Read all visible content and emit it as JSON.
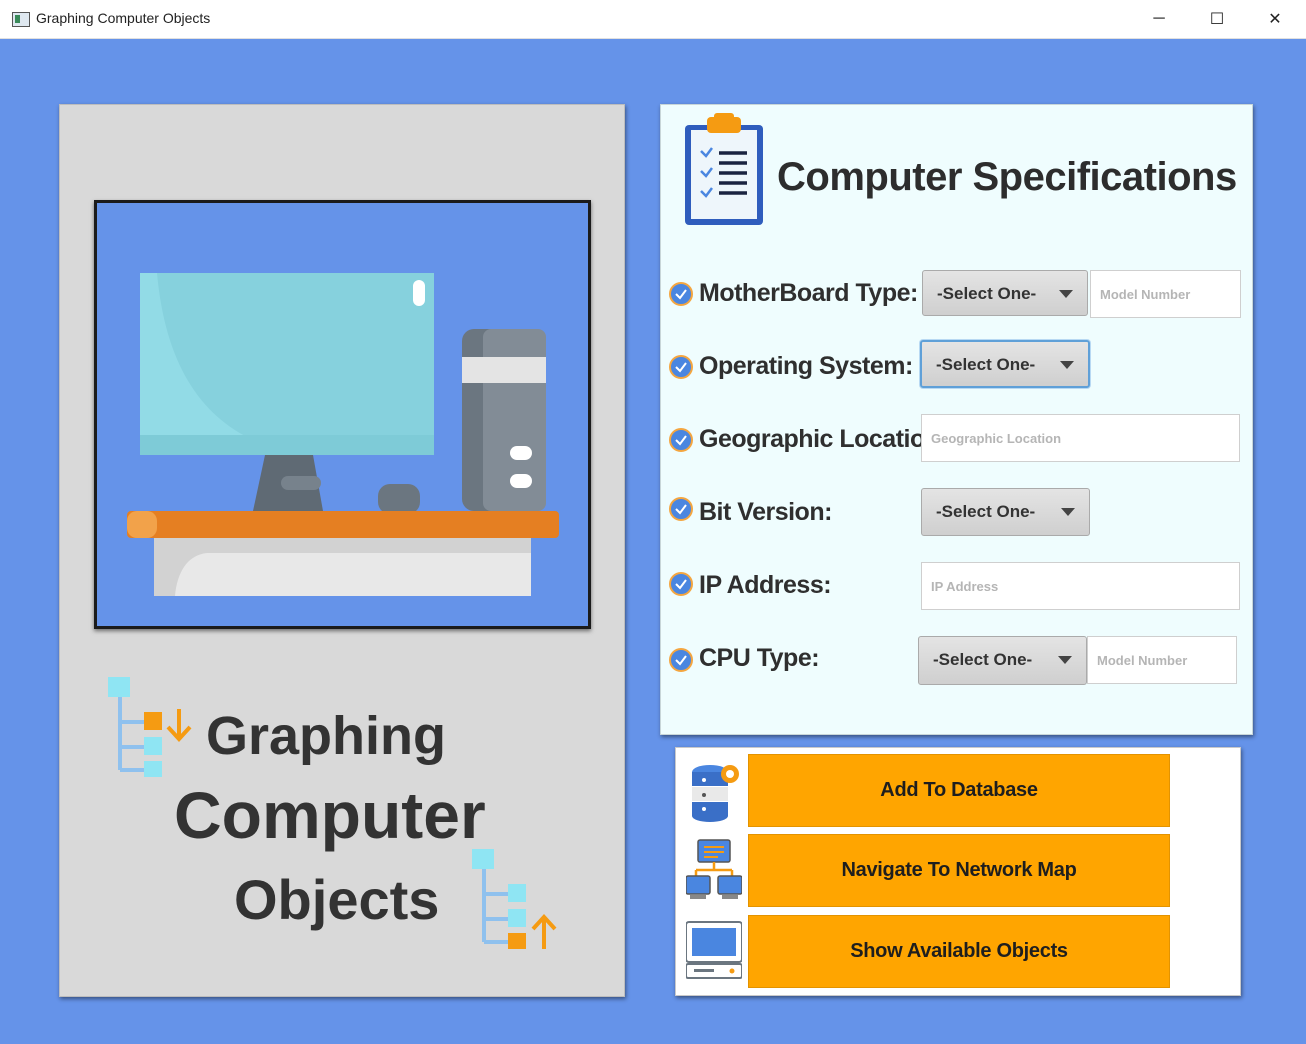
{
  "window": {
    "title": "Graphing Computer Objects",
    "minimize": "─",
    "maximize": "☐",
    "close": "✕"
  },
  "brand": {
    "line1": "Graphing",
    "line2": "Computer",
    "line3": "Objects"
  },
  "specs": {
    "title": "Computer Specifications",
    "rows": [
      {
        "label": "MotherBoard Type:",
        "select": "-Select One-",
        "input_placeholder": "Model Number"
      },
      {
        "label": "Operating System:",
        "select": "-Select One-"
      },
      {
        "label": "Geographic Location:",
        "input_placeholder": "Geographic Location"
      },
      {
        "label": "Bit Version:",
        "select": "-Select One-"
      },
      {
        "label": "IP Address:",
        "input_placeholder": "IP Address"
      },
      {
        "label": "CPU Type:",
        "select": "-Select One-",
        "input_placeholder": "Model Number"
      }
    ]
  },
  "actions": {
    "add": "Add To Database",
    "navigate": "Navigate To Network Map",
    "show": "Show Available Objects"
  },
  "colors": {
    "background": "#6593e9",
    "accent": "#ffa500",
    "panel": "#d9d9d9",
    "spec_panel": "#effdfe"
  }
}
